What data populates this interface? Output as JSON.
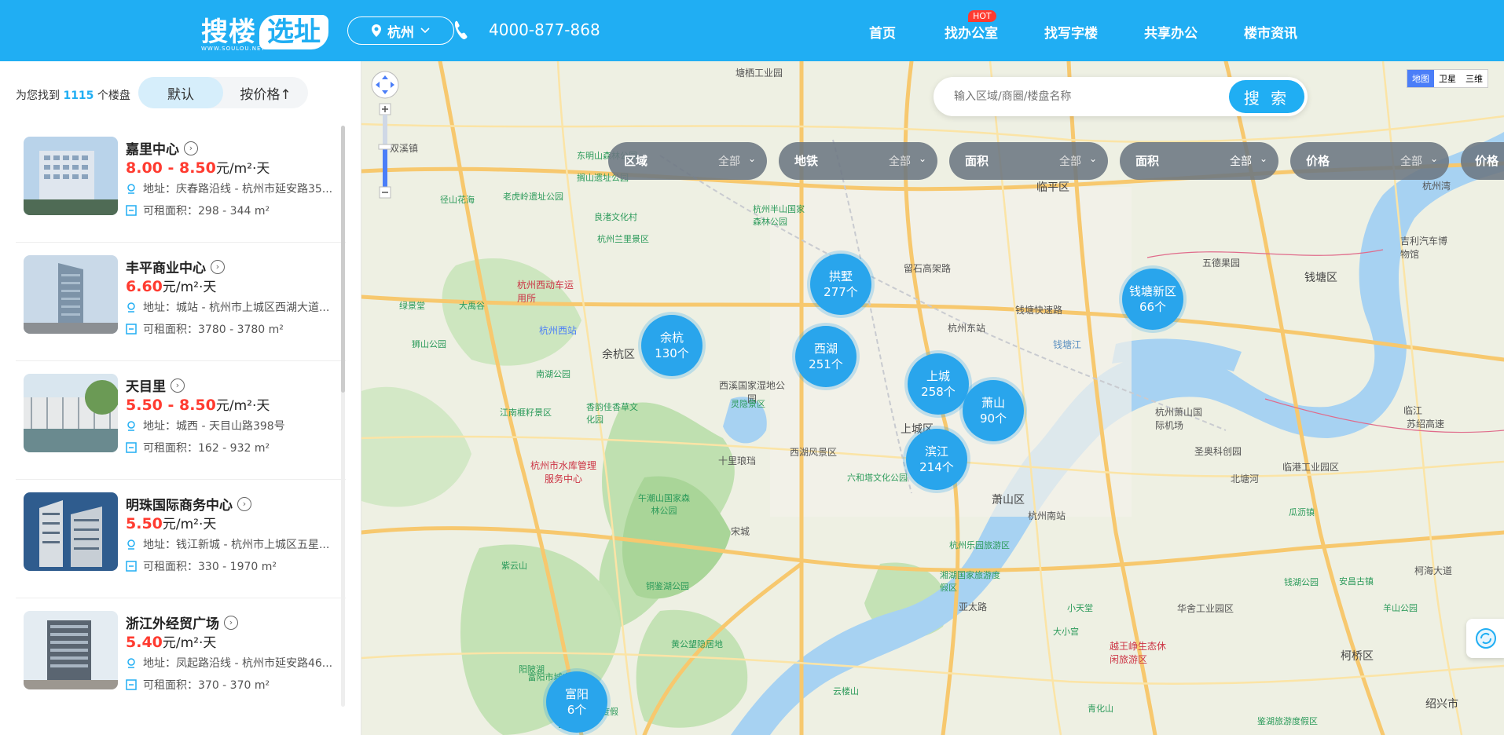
{
  "header": {
    "logo_main": "搜楼",
    "logo_box": "选址",
    "logo_sub": "WWW.SOULOU.NET",
    "city": "杭州",
    "phone": "4000-877-868",
    "nav": [
      "首页",
      "找办公室",
      "找写字楼",
      "共享办公",
      "楼市资讯"
    ],
    "hot_badge": "HOT"
  },
  "sidebar": {
    "found_prefix": "为您找到",
    "found_count": "1115",
    "found_suffix": "个楼盘",
    "sort_default": "默认",
    "sort_price": "按价格↑",
    "listings": [
      {
        "title": "嘉里中心",
        "price": "8.00 - 8.50",
        "unit": "元/m²·天",
        "addr": "地址：庆春路沿线 - 杭州市延安路35...",
        "area": "可租面积：298 - 344 m²"
      },
      {
        "title": "丰平商业中心",
        "price": "6.60",
        "unit": "元/m²·天",
        "addr": "地址：城站 - 杭州市上城区西湖大道...",
        "area": "可租面积：3780 - 3780 m²"
      },
      {
        "title": "天目里",
        "price": "5.50 - 8.50",
        "unit": "元/m²·天",
        "addr": "地址：城西 - 天目山路398号",
        "area": "可租面积：162 - 932 m²"
      },
      {
        "title": "明珠国际商务中心",
        "price": "5.50",
        "unit": "元/m²·天",
        "addr": "地址：钱江新城 - 杭州市上城区五星...",
        "area": "可租面积：330 - 1970 m²"
      },
      {
        "title": "浙江外经贸广场",
        "price": "5.40",
        "unit": "元/m²·天",
        "addr": "地址：凤起路沿线 - 杭州市延安路46...",
        "area": "可租面积：370 - 370 m²"
      }
    ]
  },
  "map": {
    "search_placeholder": "输入区域/商圈/楼盘名称",
    "search_btn": "搜 索",
    "maptypes": [
      "地图",
      "卫星",
      "三维"
    ],
    "filters": [
      {
        "label": "区域",
        "value": "全部"
      },
      {
        "label": "地铁",
        "value": "全部"
      },
      {
        "label": "面积",
        "value": "全部"
      },
      {
        "label": "面积",
        "value": "全部"
      },
      {
        "label": "价格",
        "value": "全部"
      },
      {
        "label": "价格",
        "value": ""
      }
    ],
    "clusters": [
      {
        "name": "拱墅",
        "count": "277个"
      },
      {
        "name": "余杭",
        "count": "130个"
      },
      {
        "name": "西湖",
        "count": "251个"
      },
      {
        "name": "上城",
        "count": "258个"
      },
      {
        "name": "萧山",
        "count": "90个"
      },
      {
        "name": "滨江",
        "count": "214个"
      },
      {
        "name": "钱塘新区",
        "count": "66个"
      },
      {
        "name": "富阳",
        "count": "6个"
      }
    ],
    "labels": [
      "临平区",
      "余杭区",
      "钱塘区",
      "萧山区",
      "上城区",
      "绍兴市",
      "亚太路",
      "柯桥区",
      "钱塘快速路",
      "留石高架路",
      "西湖风景区",
      "西溪国家湿地公园",
      "杭州东站",
      "杭州南站",
      "杭州萧山国际机场",
      "北塘河",
      "苏绍高速",
      "柯海大道",
      "双溪镇",
      "径山花海",
      "杭州西动车运用所",
      "东明山森林公园",
      "老虎岭遗址公园",
      "杭州西站",
      "良渚文化村",
      "杭州兰里景区",
      "大禹谷",
      "绿景堂",
      "狮山公园",
      "南湖公园",
      "江南榧籽景区",
      "香韵佳香草文化园",
      "灵隐景区",
      "杭州市水库管理服务中心",
      "午潮山国家森林公园",
      "六和塔文化公园",
      "杭州乐园旅游区",
      "湘湖国家旅游度假区",
      "钱湖公园",
      "黄公望隐居地",
      "富阳市城市森林公园",
      "新沙岛旅游度假区",
      "大小宫",
      "越王峥生态休闲旅游区",
      "鉴湖旅游度假区",
      "华舍工业园区",
      "羊山公园",
      "吉利汽车博物馆",
      "圣奥科创园",
      "临港工业园区",
      "五德果园",
      "杭州半山国家森林公园",
      "塘栖工业园",
      "搁山遗址公园",
      "紫云山",
      "铜鉴湖公园",
      "阳陂湖",
      "云楼山",
      "宋城",
      "十里琅珰",
      "安昌古镇",
      "瓜沥镇",
      "青化山",
      "小天堂",
      "杭州湾",
      "临江",
      "钱塘江"
    ]
  },
  "colors": {
    "brand": "#20aef3",
    "price": "#ff3b30",
    "cluster": "#29a5ec",
    "filter_bg": "#6c7682"
  }
}
